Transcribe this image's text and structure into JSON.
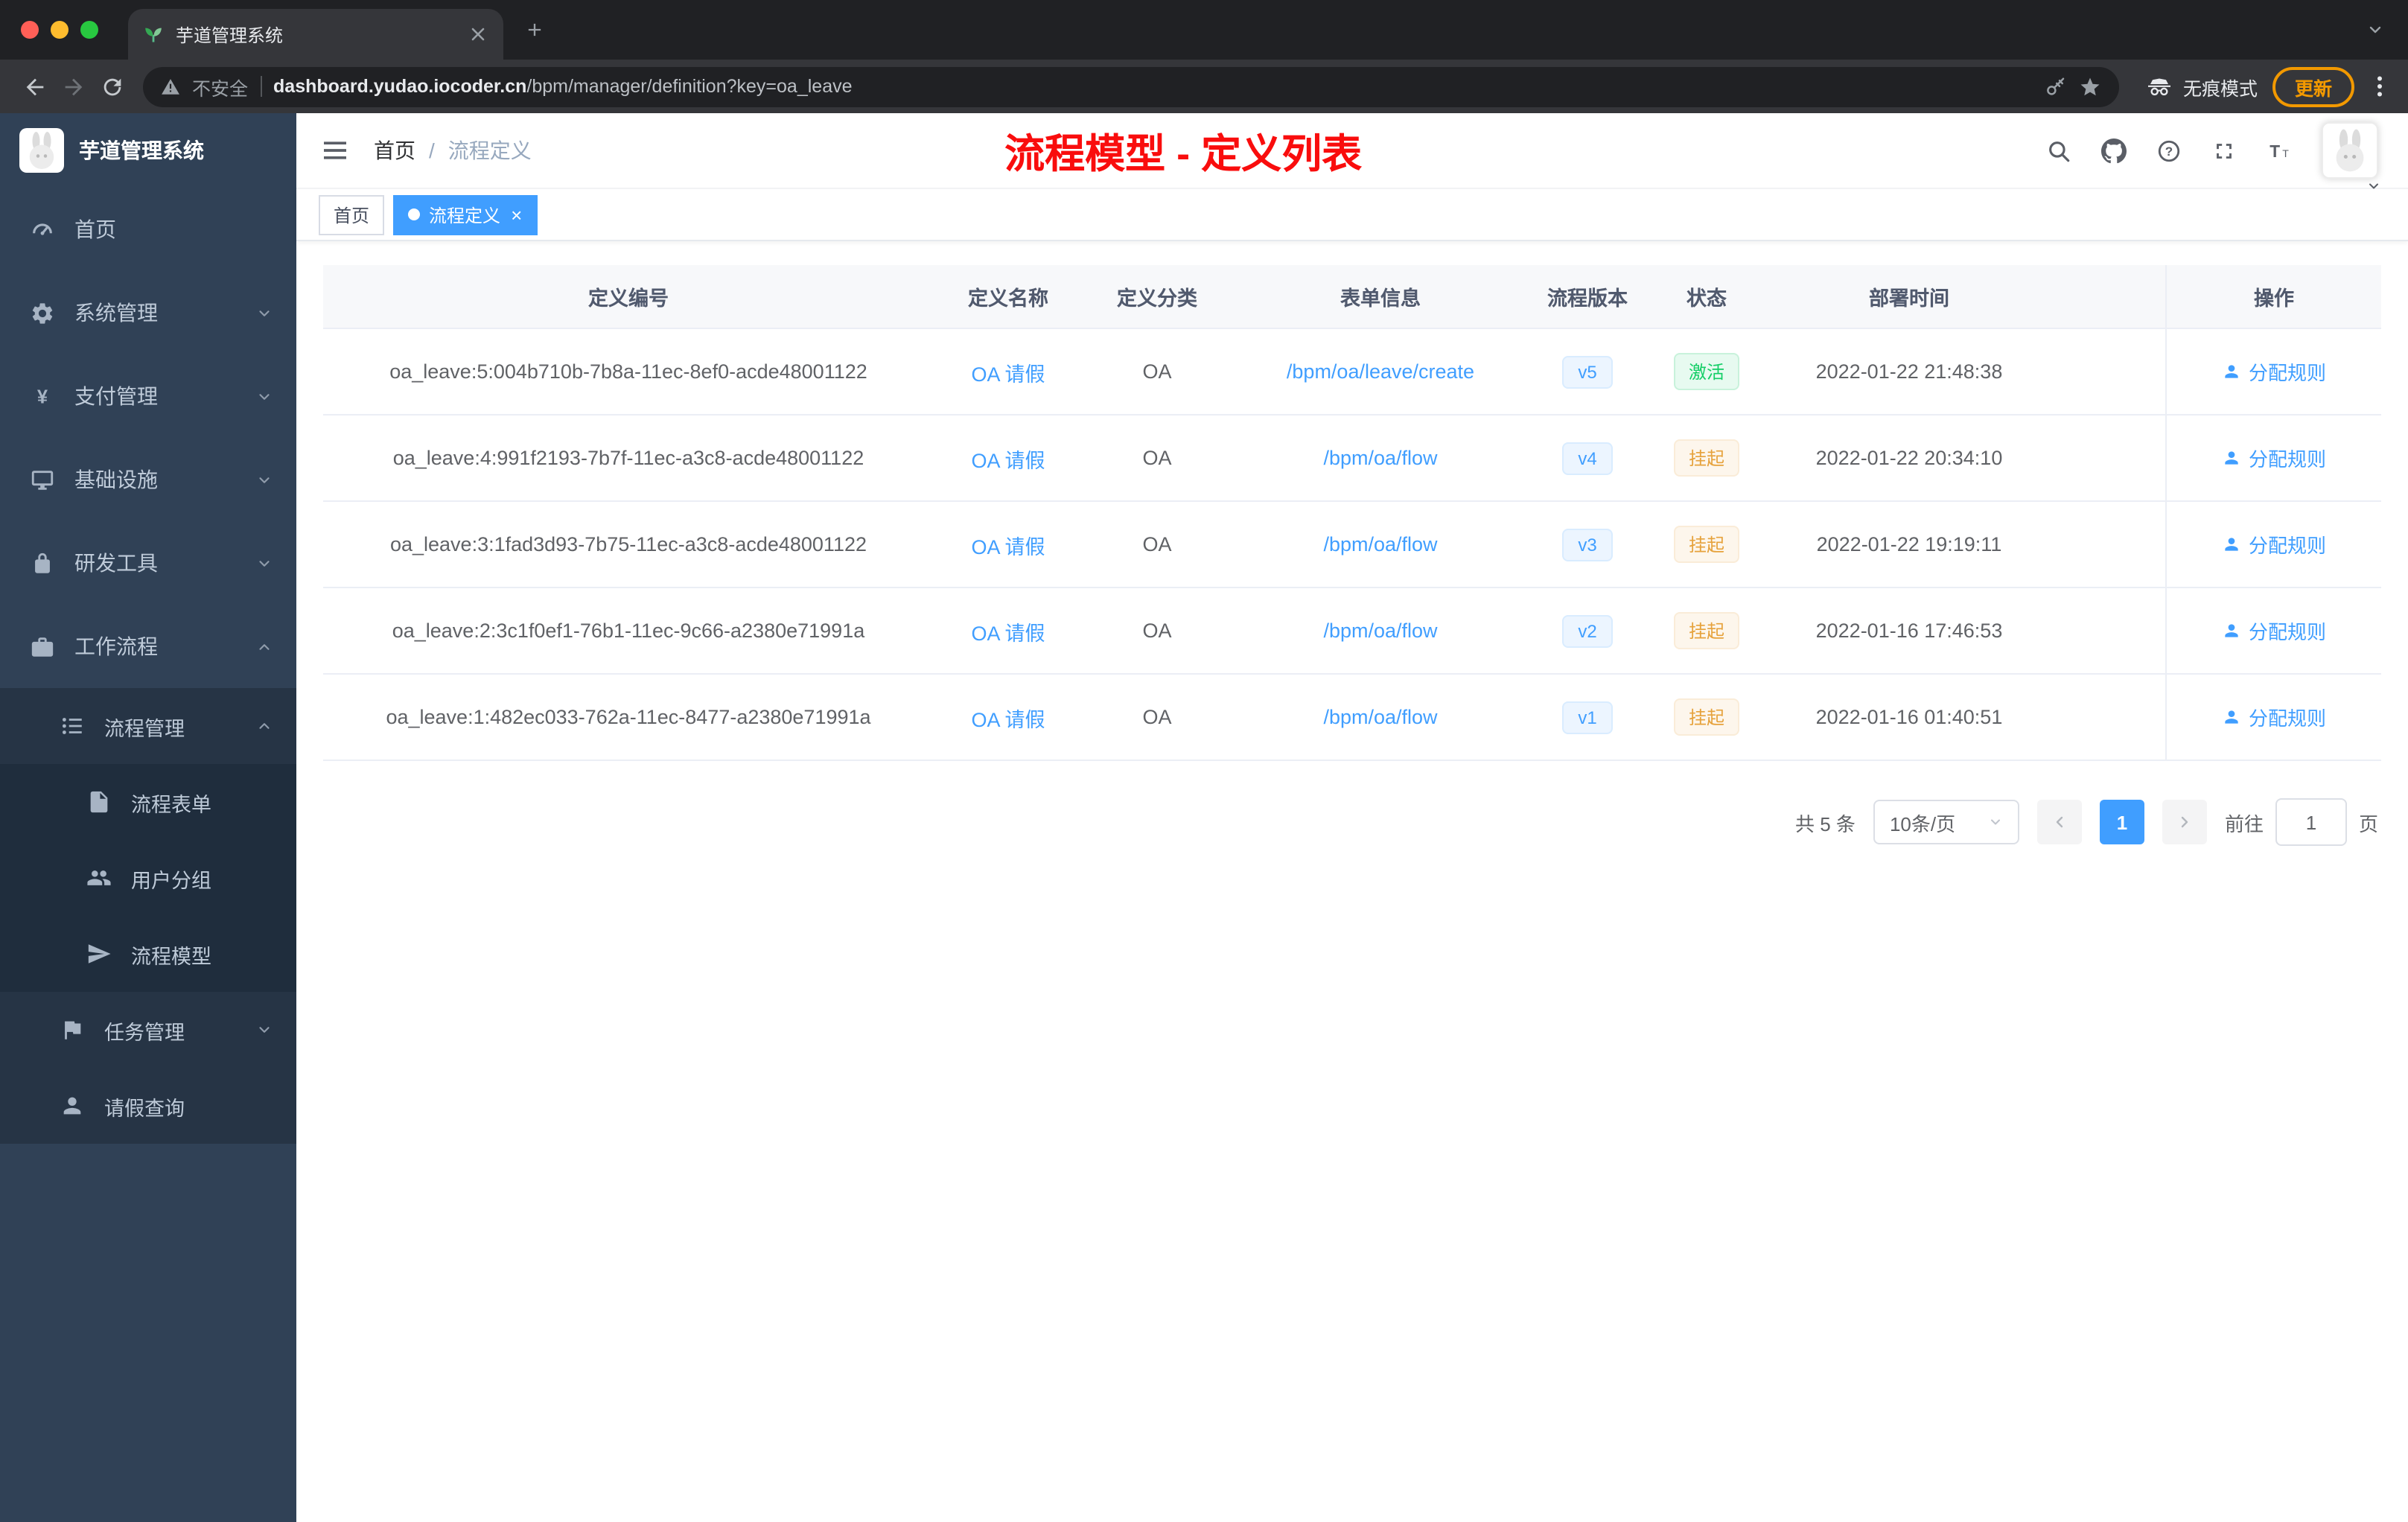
{
  "browser": {
    "tab_title": "芋道管理系统",
    "security_label": "不安全",
    "url_domain": "dashboard.yudao.iocoder.cn",
    "url_path": "/bpm/manager/definition?key=oa_leave",
    "incognito_label": "无痕模式",
    "update_label": "更新"
  },
  "sidebar": {
    "logo_title": "芋道管理系统",
    "items": [
      {
        "label": "首页",
        "icon": "dashboard-icon"
      },
      {
        "label": "系统管理",
        "icon": "gear-icon"
      },
      {
        "label": "支付管理",
        "icon": "yen-icon"
      },
      {
        "label": "基础设施",
        "icon": "monitor-icon"
      },
      {
        "label": "研发工具",
        "icon": "lock-icon"
      },
      {
        "label": "工作流程",
        "icon": "briefcase-icon"
      },
      {
        "label": "流程管理",
        "icon": "list-icon"
      },
      {
        "label": "流程表单",
        "icon": "document-icon"
      },
      {
        "label": "用户分组",
        "icon": "people-icon"
      },
      {
        "label": "流程模型",
        "icon": "send-icon"
      },
      {
        "label": "任务管理",
        "icon": "flag-icon"
      },
      {
        "label": "请假查询",
        "icon": "user-icon"
      }
    ]
  },
  "header": {
    "breadcrumb": {
      "home": "首页",
      "separator": "/",
      "current": "流程定义"
    },
    "page_title": "流程模型 - 定义列表"
  },
  "tags": {
    "home": "首页",
    "active": "流程定义",
    "close": "×"
  },
  "table": {
    "columns": [
      "定义编号",
      "定义名称",
      "定义分类",
      "表单信息",
      "流程版本",
      "状态",
      "部署时间",
      "操作"
    ],
    "rows": [
      {
        "id": "oa_leave:5:004b710b-7b8a-11ec-8ef0-acde48001122",
        "name": "OA 请假",
        "category": "OA",
        "form": "/bpm/oa/leave/create",
        "version": "v5",
        "status": "激活",
        "status_type": "success",
        "deployed": "2022-01-22 21:48:38",
        "action": "分配规则"
      },
      {
        "id": "oa_leave:4:991f2193-7b7f-11ec-a3c8-acde48001122",
        "name": "OA 请假",
        "category": "OA",
        "form": "/bpm/oa/flow",
        "version": "v4",
        "status": "挂起",
        "status_type": "warning",
        "deployed": "2022-01-22 20:34:10",
        "action": "分配规则"
      },
      {
        "id": "oa_leave:3:1fad3d93-7b75-11ec-a3c8-acde48001122",
        "name": "OA 请假",
        "category": "OA",
        "form": "/bpm/oa/flow",
        "version": "v3",
        "status": "挂起",
        "status_type": "warning",
        "deployed": "2022-01-22 19:19:11",
        "action": "分配规则"
      },
      {
        "id": "oa_leave:2:3c1f0ef1-76b1-11ec-9c66-a2380e71991a",
        "name": "OA 请假",
        "category": "OA",
        "form": "/bpm/oa/flow",
        "version": "v2",
        "status": "挂起",
        "status_type": "warning",
        "deployed": "2022-01-16 17:46:53",
        "action": "分配规则"
      },
      {
        "id": "oa_leave:1:482ec033-762a-11ec-8477-a2380e71991a",
        "name": "OA 请假",
        "category": "OA",
        "form": "/bpm/oa/flow",
        "version": "v1",
        "status": "挂起",
        "status_type": "warning",
        "deployed": "2022-01-16 01:40:51",
        "action": "分配规则"
      }
    ]
  },
  "pagination": {
    "total": "共 5 条",
    "page_size": "10条/页",
    "current_page": "1",
    "goto_label": "前往",
    "goto_value": "1",
    "goto_suffix": "页"
  },
  "colors": {
    "accent_blue": "#409eff",
    "annotation_red": "#f90d0d",
    "sidebar_bg": "#304156",
    "success_green": "#13ce66",
    "warning_orange": "#e6a23c"
  },
  "icons": [
    "sprout-favicon-icon",
    "close-icon",
    "new-tab-icon",
    "tab-search-chevron-icon",
    "back-icon",
    "forward-icon",
    "reload-icon",
    "warning-icon",
    "key-icon",
    "star-icon",
    "incognito-icon",
    "more-menu-icon",
    "hamburger-icon",
    "search-icon",
    "github-icon",
    "help-icon",
    "fullscreen-icon",
    "font-size-icon",
    "chevron-down-icon",
    "chevron-up-icon",
    "dashboard-icon",
    "gear-icon",
    "yen-icon",
    "monitor-icon",
    "lock-icon",
    "briefcase-icon",
    "list-icon",
    "document-icon",
    "people-icon",
    "send-icon",
    "flag-icon",
    "user-icon"
  ]
}
